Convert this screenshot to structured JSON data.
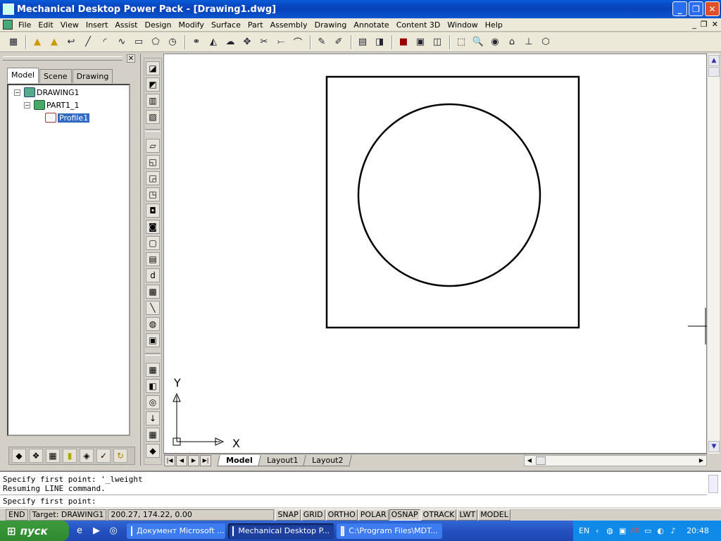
{
  "window": {
    "title": "Mechanical Desktop Power Pack - [Drawing1.dwg]"
  },
  "menu": [
    "File",
    "Edit",
    "View",
    "Insert",
    "Assist",
    "Design",
    "Modify",
    "Surface",
    "Part",
    "Assembly",
    "Drawing",
    "Annotate",
    "Content 3D",
    "Window",
    "Help"
  ],
  "browser": {
    "tabs": [
      "Model",
      "Scene",
      "Drawing"
    ],
    "tree": {
      "root": "DRAWING1",
      "part": "PART1_1",
      "profile": "Profile1"
    }
  },
  "layout_tabs": [
    "Model",
    "Layout1",
    "Layout2"
  ],
  "ucs": {
    "x_label": "X",
    "y_label": "Y"
  },
  "command": {
    "lines": [
      "Specify first point: '_lweight",
      "Resuming LINE command."
    ],
    "prompt": "Specify first point:"
  },
  "status": {
    "mode": "END",
    "target": "Target: DRAWING1",
    "coords": "200.27, 174.22, 0.00",
    "toggles": [
      "SNAP",
      "GRID",
      "ORTHO",
      "POLAR",
      "OSNAP",
      "OTRACK",
      "LWT",
      "MODEL"
    ]
  },
  "taskbar": {
    "start": "пуск",
    "tasks": [
      "Документ Microsoft ...",
      "Mechanical Desktop P...",
      "C:\\Program Files\\MDT..."
    ],
    "lang": "EN",
    "clock": "20:48"
  },
  "icons": {
    "app": "mdt-app-icon",
    "minimize": "minimize-icon",
    "maximize": "restore-icon",
    "close": "close-icon"
  }
}
